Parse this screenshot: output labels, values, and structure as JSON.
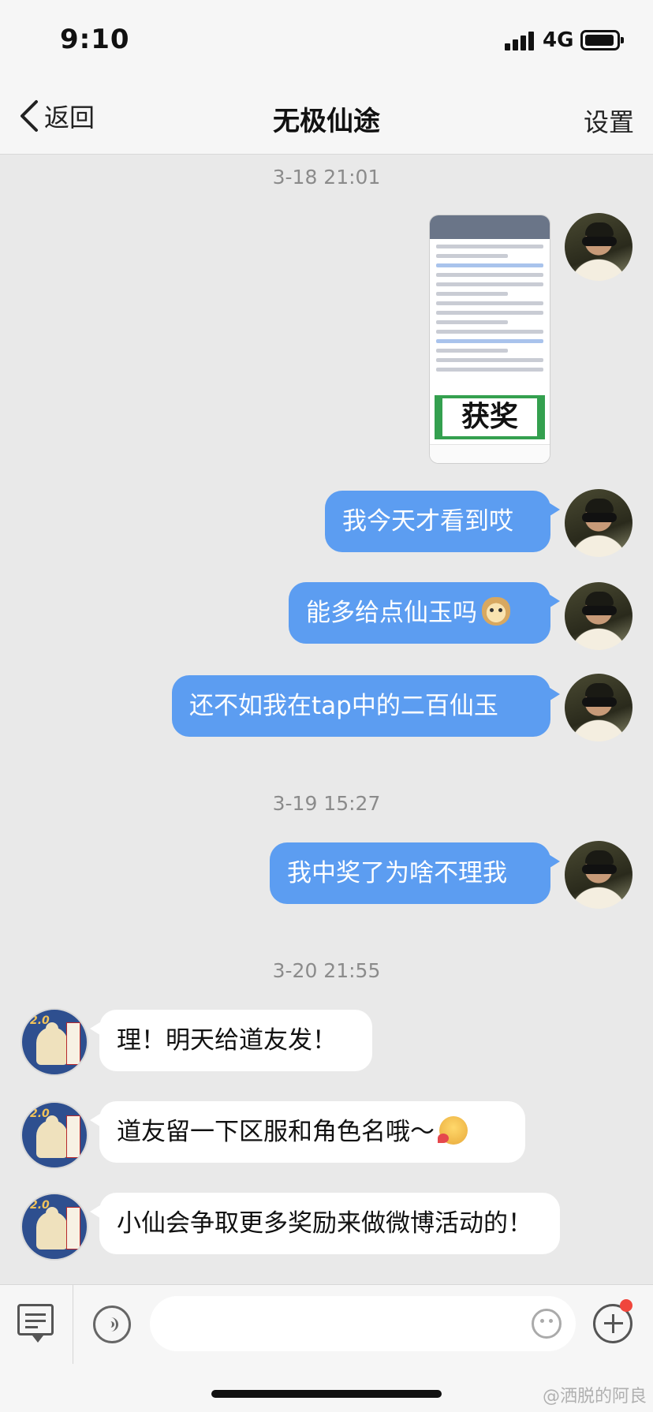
{
  "status_bar": {
    "time": "9:10",
    "network": "4G"
  },
  "nav": {
    "back_label": "返回",
    "title": "无极仙途",
    "settings_label": "设置"
  },
  "messages": {
    "ts1": "3-18 21:01",
    "shared_image": {
      "award_text": "获奖"
    },
    "m1": "我今天才看到哎",
    "m2": "能多给点仙玉吗",
    "m3": "还不如我在tap中的二百仙玉",
    "ts2": "3-19 15:27",
    "m4": "我中奖了为啥不理我",
    "ts3": "3-20 21:55",
    "r1": "理！明天给道友发！",
    "r2": "道友留一下区服和角色名哦～",
    "r3": "小仙会争取更多奖励来做微博活动的！"
  },
  "avatars": {
    "other_badge": "2.0"
  },
  "input_bar": {
    "placeholder": ""
  },
  "watermark": "@洒脱的阿良",
  "colors": {
    "outgoing_bubble": "#5c9df1",
    "incoming_bubble": "#ffffff",
    "background": "#e9e9e9",
    "notification_dot": "#f0463c"
  }
}
